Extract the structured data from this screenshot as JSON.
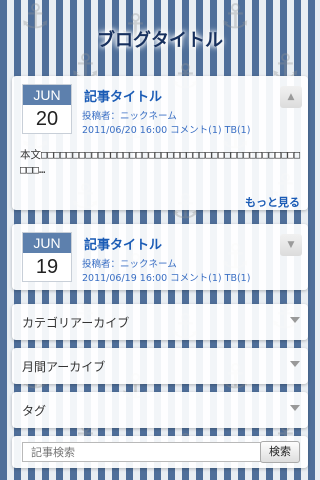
{
  "blog_title": "ブログタイトル",
  "posts": [
    {
      "month": "JUN",
      "day": "20",
      "title": "記事タイトル",
      "author_line": "投稿者：ニックネーム",
      "meta_line": "2011/06/20 16:00 コメント(1) TB(1)",
      "body": "本文□□□□□□□□□□□□□□□□□□□□□□□□□□□□□□□□□□□□□□□□□□□□…",
      "read_more": "もっと見る",
      "toggle_icon": "arrow-up-icon"
    },
    {
      "month": "JUN",
      "day": "19",
      "title": "記事タイトル",
      "author_line": "投稿者：ニックネーム",
      "meta_line": "2011/06/19 16:00 コメント(1) TB(1)",
      "toggle_icon": "arrow-down-icon"
    }
  ],
  "sections": [
    {
      "label": "カテゴリアーカイブ"
    },
    {
      "label": "月間アーカイブ"
    },
    {
      "label": "タグ"
    }
  ],
  "search": {
    "placeholder": "記事検索",
    "button_label": "検索"
  },
  "colors": {
    "stripe_blue": "#4f6f9a",
    "title_blue": "#1a5bb5",
    "date_header": "#5d80ad"
  }
}
